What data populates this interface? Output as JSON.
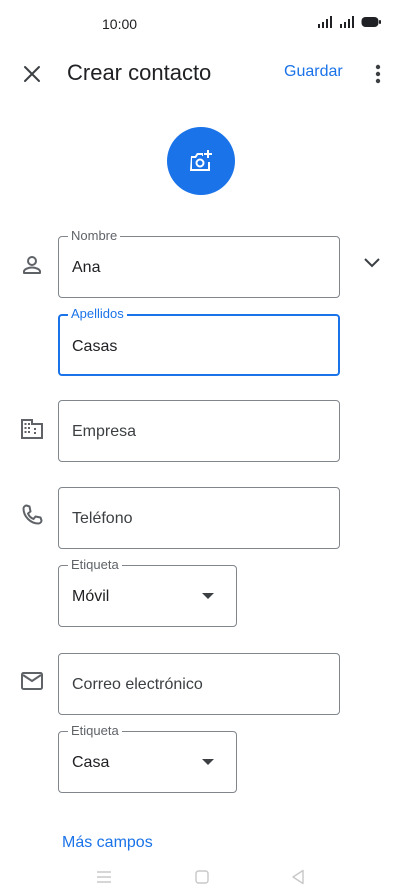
{
  "status_bar": {
    "time": "10:00"
  },
  "header": {
    "title": "Crear contacto",
    "save_label": "Guardar"
  },
  "form": {
    "name": {
      "label": "Nombre",
      "value": "Ana"
    },
    "surname": {
      "label": "Apellidos",
      "value": "Casas"
    },
    "company": {
      "placeholder": "Empresa"
    },
    "phone": {
      "placeholder": "Teléfono"
    },
    "phone_label": {
      "label": "Etiqueta",
      "value": "Móvil"
    },
    "email": {
      "placeholder": "Correo electrónico"
    },
    "email_label": {
      "label": "Etiqueta",
      "value": "Casa"
    },
    "more_fields": "Más campos"
  },
  "colors": {
    "accent": "#1a73e8",
    "outline": "#80868b",
    "icon": "#5f6368"
  },
  "icons": [
    "close-icon",
    "more-vert-icon",
    "add-photo-icon",
    "person-icon",
    "chevron-down-icon",
    "business-icon",
    "phone-icon",
    "mail-icon",
    "arrow-drop-down-icon"
  ]
}
